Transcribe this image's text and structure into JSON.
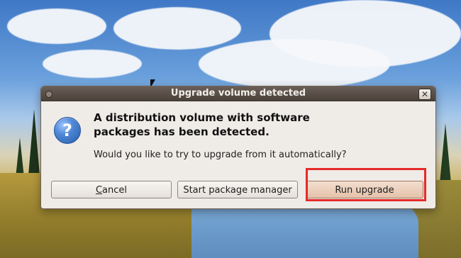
{
  "dialog": {
    "title": "Upgrade volume detected",
    "headline_line1": "A distribution volume with software",
    "headline_line2": "packages has been detected.",
    "question": "Would you like to try to upgrade from it automatically?",
    "icon": "question-icon",
    "buttons": {
      "cancel_label_first": "C",
      "cancel_label_rest": "ancel",
      "start_package_manager_label": "Start package manager",
      "run_upgrade_label": "Run upgrade"
    },
    "close_glyph": "✕"
  },
  "highlight": {
    "color": "#e52a2a"
  }
}
